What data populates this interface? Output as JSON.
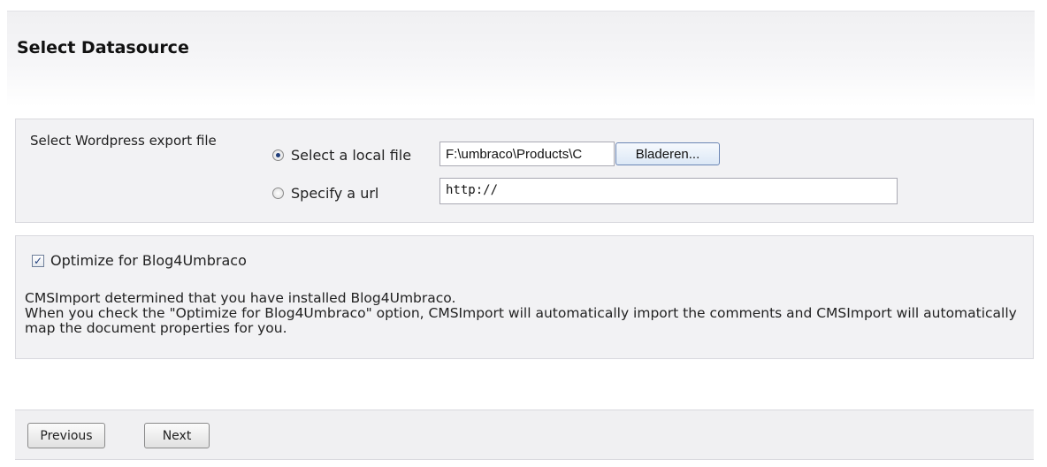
{
  "header": {
    "title": "Select Datasource"
  },
  "datasource": {
    "label": "Select Wordpress export file",
    "local_option_label": "Select a local file",
    "local_file_value": "F:\\umbraco\\Products\\C",
    "browse_label": "Bladeren...",
    "url_option_label": "Specify a url",
    "url_value": "http://",
    "selected_option": "local"
  },
  "optimize": {
    "checkbox_label": "Optimize for Blog4Umbraco",
    "checked": true,
    "info_line1": "CMSImport determined that you have installed Blog4Umbraco.",
    "info_line2": "When you check the \"Optimize for Blog4Umbraco\" option, CMSImport will automatically import the comments and CMSImport will automatically map the document properties for you."
  },
  "footer": {
    "previous_label": "Previous",
    "next_label": "Next"
  }
}
